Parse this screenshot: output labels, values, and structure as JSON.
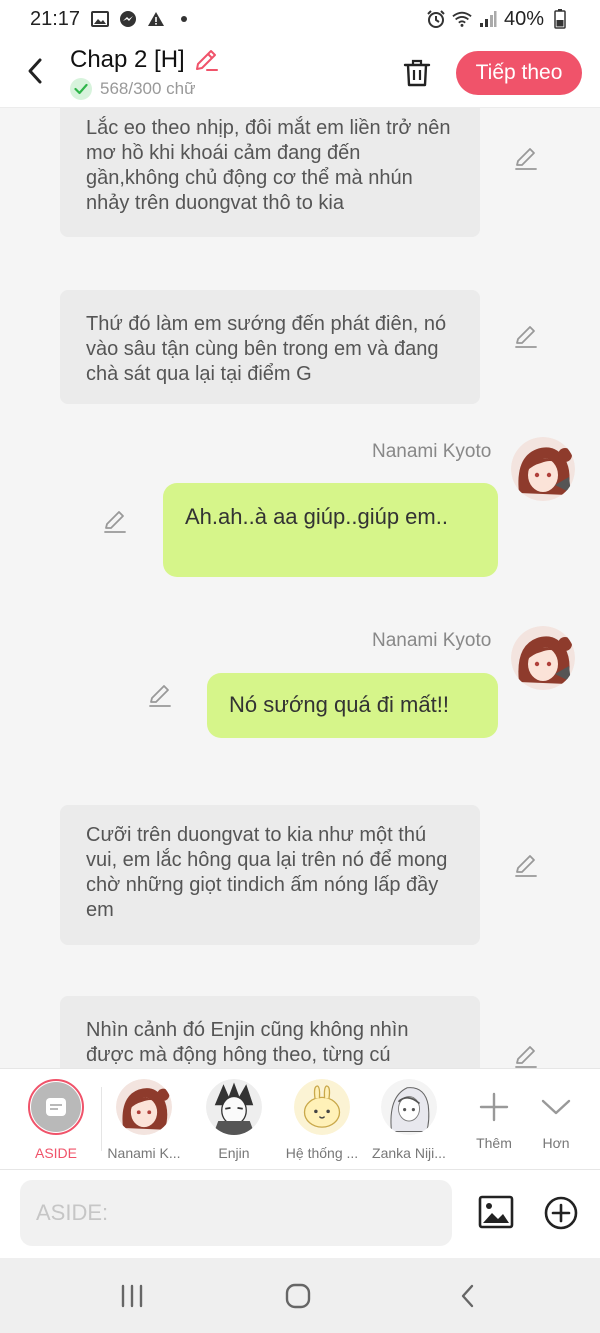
{
  "status_bar": {
    "time": "21:17",
    "battery": "40%"
  },
  "header": {
    "title": "Chap 2 [H]",
    "word_count": "568/300 chữ",
    "next_button": "Tiếp theo"
  },
  "messages": {
    "aside_1": "Lắc eo theo nhịp, đôi mắt em liền trở nên mơ hồ khi khoái cảm đang đến gần,không chủ động cơ thể mà nhún nhảy trên duongvat thô to kia",
    "aside_2": "Thứ đó làm em sướng đến phát điên, nó vào sâu tận cùng bên trong em và đang chà sát qua lại tại điểm G",
    "msg_1_sender": "Nanami Kyoto",
    "msg_1_text": "Ah.ah..à aa giúp..giúp em..",
    "msg_2_sender": "Nanami Kyoto",
    "msg_2_text": "Nó sướng quá đi mất!!",
    "aside_3": "Cưỡi trên duongvat to kia như một thú vui, em lắc hông qua lại trên nó để mong chờ những giọt tindich ấm nóng lấp đầy em",
    "aside_4": "Nhìn cảnh đó Enjin cũng không nhìn được mà động hông theo, từng cú"
  },
  "characters": {
    "aside": "ASIDE",
    "nanami": "Nanami K...",
    "enjin": "Enjin",
    "he_thong": "Hệ thống ...",
    "zanka": "Zanka Niji...",
    "more": "Thêm",
    "collapse": "Hơn"
  },
  "input": {
    "placeholder": "ASIDE:"
  },
  "colors": {
    "accent": "#f0536a",
    "bubble_green": "#d6f58a",
    "aside_bubble": "#ebebeb"
  },
  "icons": [
    "back-arrow-icon",
    "pencil-icon",
    "check-icon",
    "trash-icon",
    "image-icon",
    "plus-circle-icon",
    "plus-icon",
    "chevron-down-icon"
  ]
}
